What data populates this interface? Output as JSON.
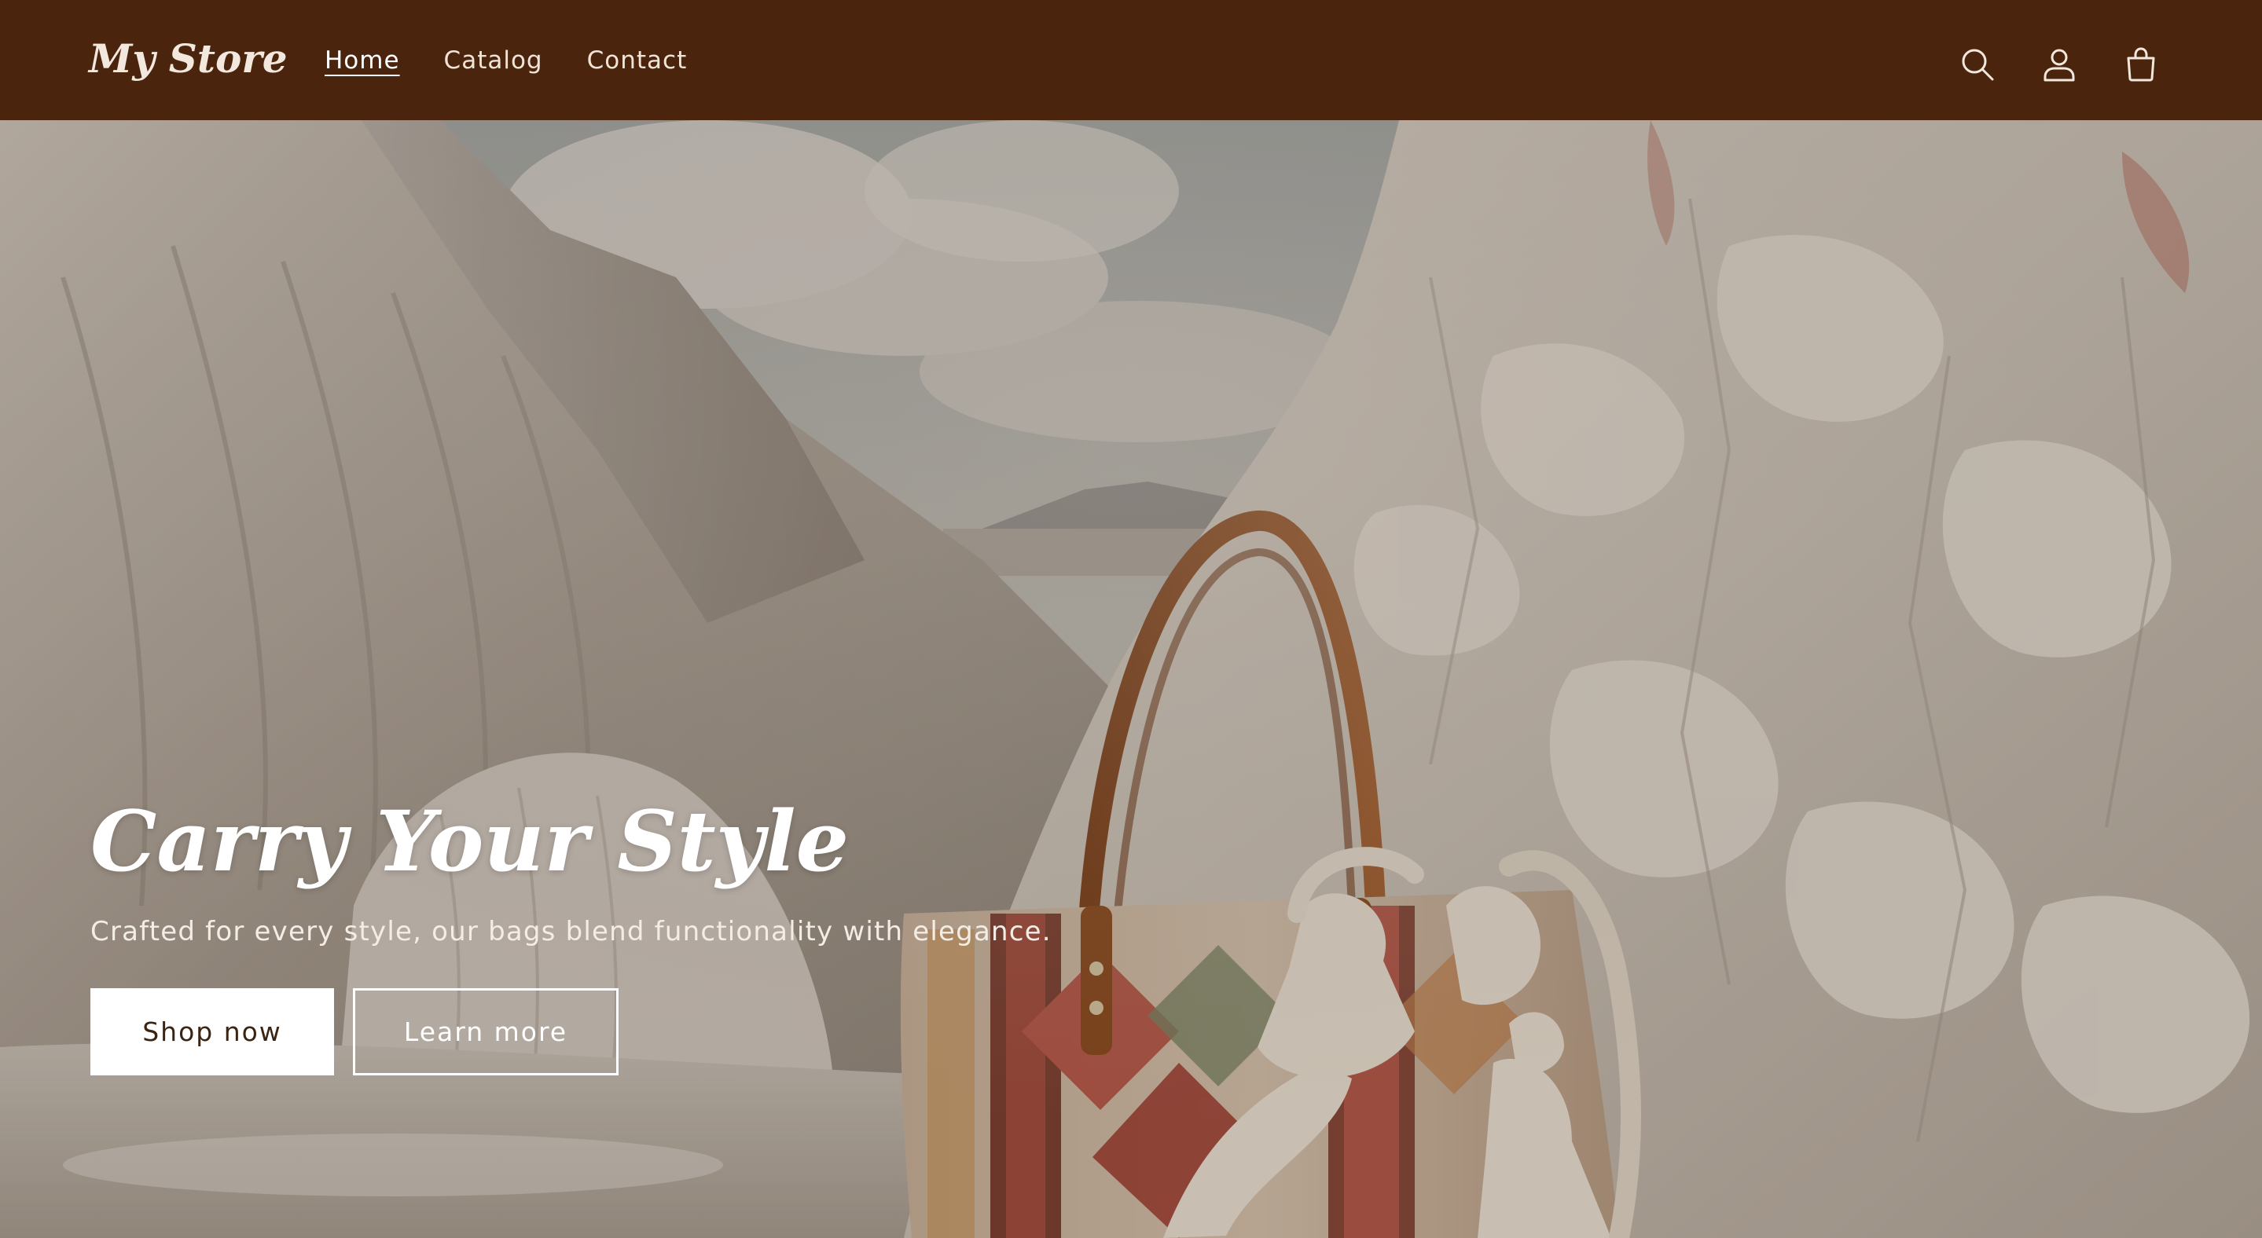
{
  "header": {
    "logo": "My Store",
    "nav": [
      {
        "label": "Home",
        "active": true
      },
      {
        "label": "Catalog",
        "active": false
      },
      {
        "label": "Contact",
        "active": false
      }
    ],
    "icons": [
      "search-icon",
      "account-icon",
      "cart-icon"
    ]
  },
  "hero": {
    "title": "Carry Your Style",
    "subtitle": "Crafted for every style, our bags blend functionality with elegance.",
    "primary_button": "Shop now",
    "secondary_button": "Learn more"
  },
  "colors": {
    "header_bg": "#4a240c",
    "button_primary_bg": "#ffffff",
    "button_primary_text": "#3a2414",
    "hero_text": "#ffffff"
  }
}
